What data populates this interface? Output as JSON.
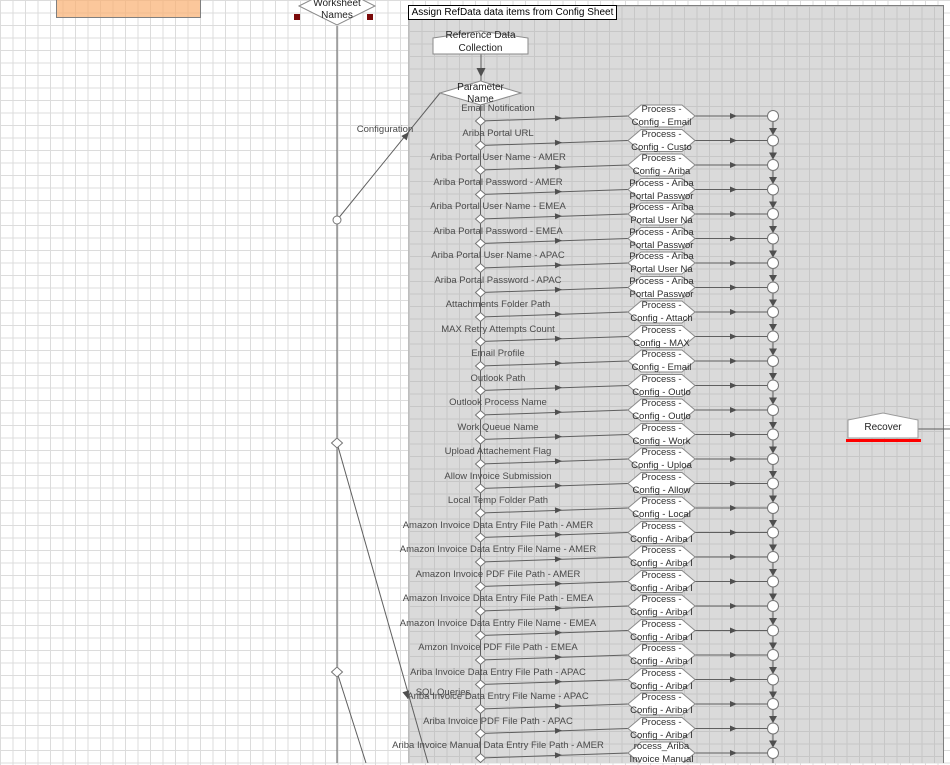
{
  "diagram": {
    "top_note": "Assign RefData data items from Config Sheet",
    "worksheet_node": {
      "line1": "Worksheet",
      "line2": "Names"
    },
    "reference_node": {
      "line1": "Reference Data",
      "line2": "Collection"
    },
    "parameter_node": {
      "line1": "Parameter",
      "line2": "Name"
    },
    "recover_node": {
      "label": "Recover"
    },
    "link_labels": {
      "configuration": "Configuration",
      "sql_queries": "SQL Queries"
    },
    "rows": [
      {
        "label": "Email Notification",
        "hex1": "Process -",
        "hex2": "Config - Email"
      },
      {
        "label": "Ariba Portal URL",
        "hex1": "Process -",
        "hex2": "Config - Custo"
      },
      {
        "label": "Ariba Portal User Name - AMER",
        "hex1": "Process -",
        "hex2": "Config - Ariba"
      },
      {
        "label": "Ariba Portal Password - AMER",
        "hex1": "Process - Ariba",
        "hex2": "Portal Passwor"
      },
      {
        "label": "Ariba Portal User Name - EMEA",
        "hex1": "Process - Ariba",
        "hex2": "Portal User Na"
      },
      {
        "label": "Ariba Portal Password - EMEA",
        "hex1": "Process - Ariba",
        "hex2": "Portal Passwor"
      },
      {
        "label": "Ariba Portal User Name - APAC",
        "hex1": "Process - Ariba",
        "hex2": "Portal User Na"
      },
      {
        "label": "Ariba Portal Password - APAC",
        "hex1": "Process - Ariba",
        "hex2": "Portal Passwor"
      },
      {
        "label": "Attachments Folder Path",
        "hex1": "Process -",
        "hex2": "Config - Attach"
      },
      {
        "label": "MAX Retry Attempts Count",
        "hex1": "Process -",
        "hex2": "Config - MAX"
      },
      {
        "label": "Email Profile",
        "hex1": "Process -",
        "hex2": "Config - Email"
      },
      {
        "label": "Outlook Path",
        "hex1": "Process -",
        "hex2": "Config - Outlo"
      },
      {
        "label": "Outlook Process Name",
        "hex1": "Process -",
        "hex2": "Config - Outlo"
      },
      {
        "label": "Work Queue Name",
        "hex1": "Process -",
        "hex2": "Config - Work"
      },
      {
        "label": "Upload Attachement Flag",
        "hex1": "Process -",
        "hex2": "Config - Uploa"
      },
      {
        "label": "Allow Invoice Submission",
        "hex1": "Process -",
        "hex2": "Config - Allow"
      },
      {
        "label": "Local Temp Folder Path",
        "hex1": "Process -",
        "hex2": "Config - Local"
      },
      {
        "label": "Amazon Invoice Data Entry File Path - AMER",
        "hex1": "Process -",
        "hex2": "Config - Ariba I"
      },
      {
        "label": "Amazon Invoice Data Entry File Name - AMER",
        "hex1": "Process -",
        "hex2": "Config - Ariba I"
      },
      {
        "label": "Amazon Invoice PDF File Path - AMER",
        "hex1": "Process -",
        "hex2": "Config - Ariba I"
      },
      {
        "label": "Amazon Invoice Data Entry File Path - EMEA",
        "hex1": "Process -",
        "hex2": "Config - Ariba I"
      },
      {
        "label": "Amazon Invoice Data Entry File Name - EMEA",
        "hex1": "Process -",
        "hex2": "Config - Ariba I"
      },
      {
        "label": "Amzon Invoice PDF File Path - EMEA",
        "hex1": "Process -",
        "hex2": "Config - Ariba I"
      },
      {
        "label": "Ariba Invoice Data Entry File Path - APAC",
        "hex1": "Process -",
        "hex2": "Config - Ariba I"
      },
      {
        "label": "Ariba Invoice Data Entry File Name - APAC",
        "hex1": "Process -",
        "hex2": "Config - Ariba I"
      },
      {
        "label": "Ariba Invoice PDF File Path - APAC",
        "hex1": "Process -",
        "hex2": "Config - Ariba I"
      },
      {
        "label": "Ariba Invoice Manual Data Entry File Path - AMER",
        "hex1": "rocess_Ariba",
        "hex2": "Invoice Manual"
      }
    ],
    "colors": {
      "selection_region": "#dadada",
      "grid_line": "#dcdcdc",
      "region_grid_line": "#c7c7c7",
      "connector": "#5f5f5f",
      "recover_accent": "#ff0000",
      "selection_handle": "#7a0909",
      "note_fill": "#f9b274"
    }
  }
}
